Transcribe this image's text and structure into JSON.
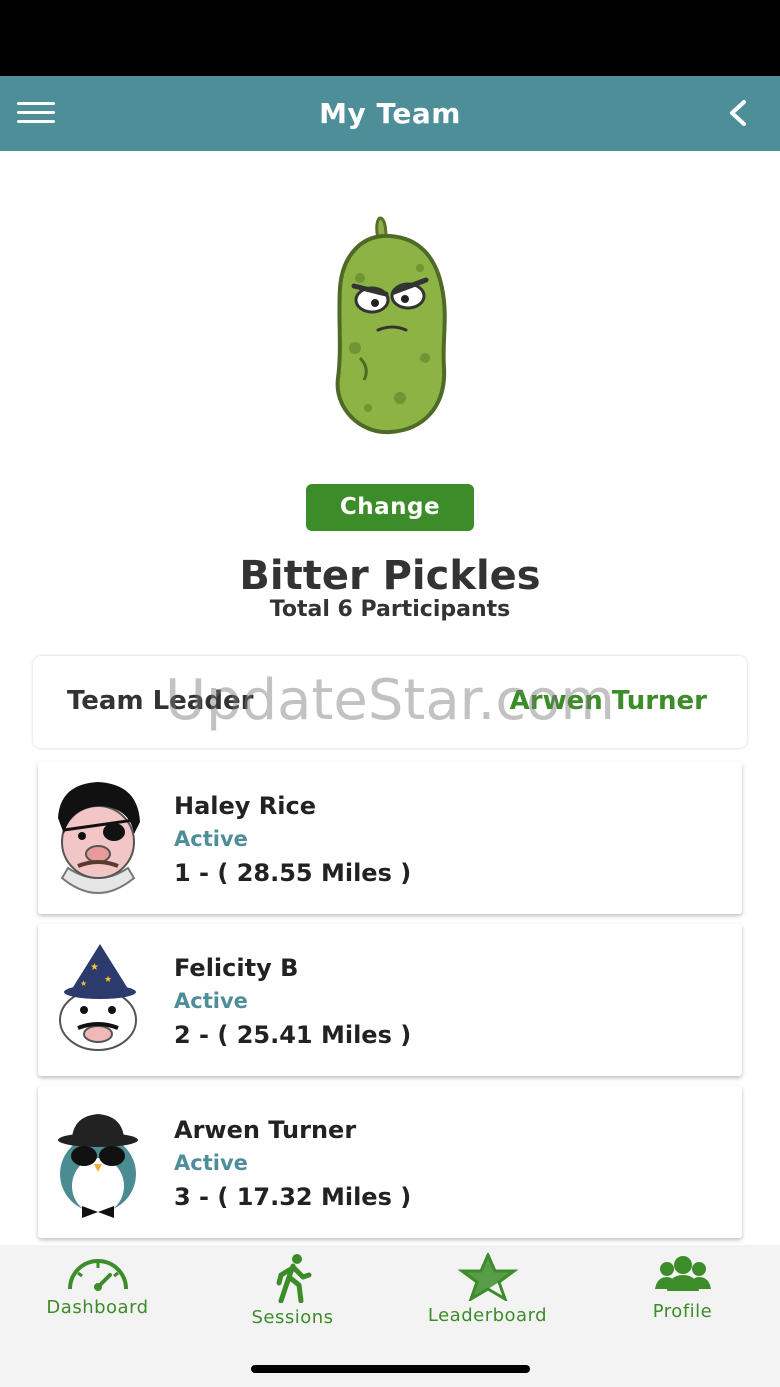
{
  "header": {
    "title": "My Team"
  },
  "team": {
    "change_label": "Change",
    "name": "Bitter Pickles",
    "total": "Total 6 Participants",
    "leader_label": "Team Leader",
    "leader_name": "Arwen Turner"
  },
  "watermark": "UpdateStar.com",
  "members": [
    {
      "name": "Haley Rice",
      "status": "Active",
      "rank_miles": "1 - ( 28.55 Miles )",
      "avatar_icon": "pirate-pig-avatar"
    },
    {
      "name": "Felicity B",
      "status": "Active",
      "rank_miles": "2 - ( 25.41 Miles )",
      "avatar_icon": "wizard-cow-avatar"
    },
    {
      "name": "Arwen Turner",
      "status": "Active",
      "rank_miles": "3 - ( 17.32 Miles )",
      "avatar_icon": "spy-penguin-avatar"
    }
  ],
  "tabs": [
    {
      "label": "Dashboard",
      "icon": "speedometer-icon"
    },
    {
      "label": "Sessions",
      "icon": "walker-icon"
    },
    {
      "label": "Leaderboard",
      "icon": "star-icon"
    },
    {
      "label": "Profile",
      "icon": "group-icon"
    }
  ],
  "colors": {
    "nav": "#4e8e99",
    "accent_green": "#3c8c2a",
    "status_teal": "#4e8e99"
  }
}
